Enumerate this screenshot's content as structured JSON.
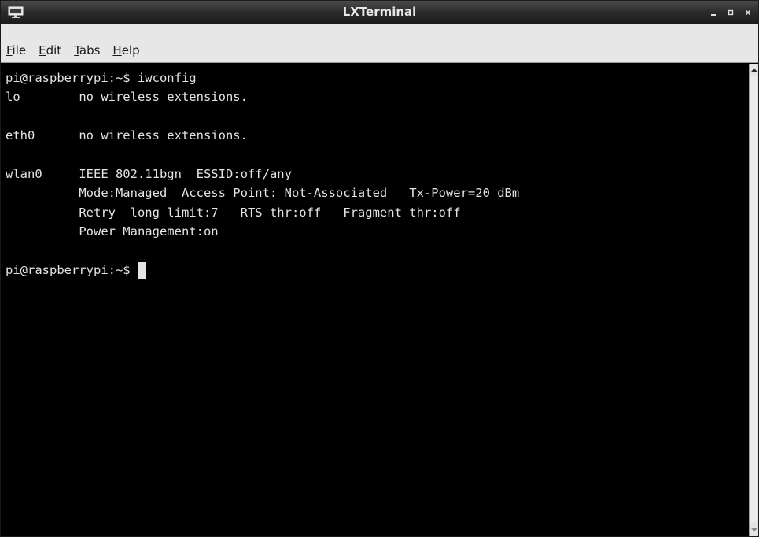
{
  "window": {
    "title": "LXTerminal",
    "controls": {
      "minimize": "_",
      "maximize": "▫",
      "close": "×"
    }
  },
  "menu": {
    "items": [
      {
        "mnemonic": "F",
        "rest": "ile"
      },
      {
        "mnemonic": "E",
        "rest": "dit"
      },
      {
        "mnemonic": "T",
        "rest": "abs"
      },
      {
        "mnemonic": "H",
        "rest": "elp"
      }
    ]
  },
  "terminal": {
    "lines": [
      "pi@raspberrypi:~$ iwconfig",
      "lo        no wireless extensions.",
      "",
      "eth0      no wireless extensions.",
      "",
      "wlan0     IEEE 802.11bgn  ESSID:off/any",
      "          Mode:Managed  Access Point: Not-Associated   Tx-Power=20 dBm",
      "          Retry  long limit:7   RTS thr:off   Fragment thr:off",
      "          Power Management:on",
      ""
    ],
    "prompt": "pi@raspberrypi:~$ "
  },
  "colors": {
    "terminal_bg": "#000000",
    "terminal_fg": "#e4e4e4",
    "titlebar": "#2b2b2b",
    "menubar": "#e7e7e7"
  }
}
